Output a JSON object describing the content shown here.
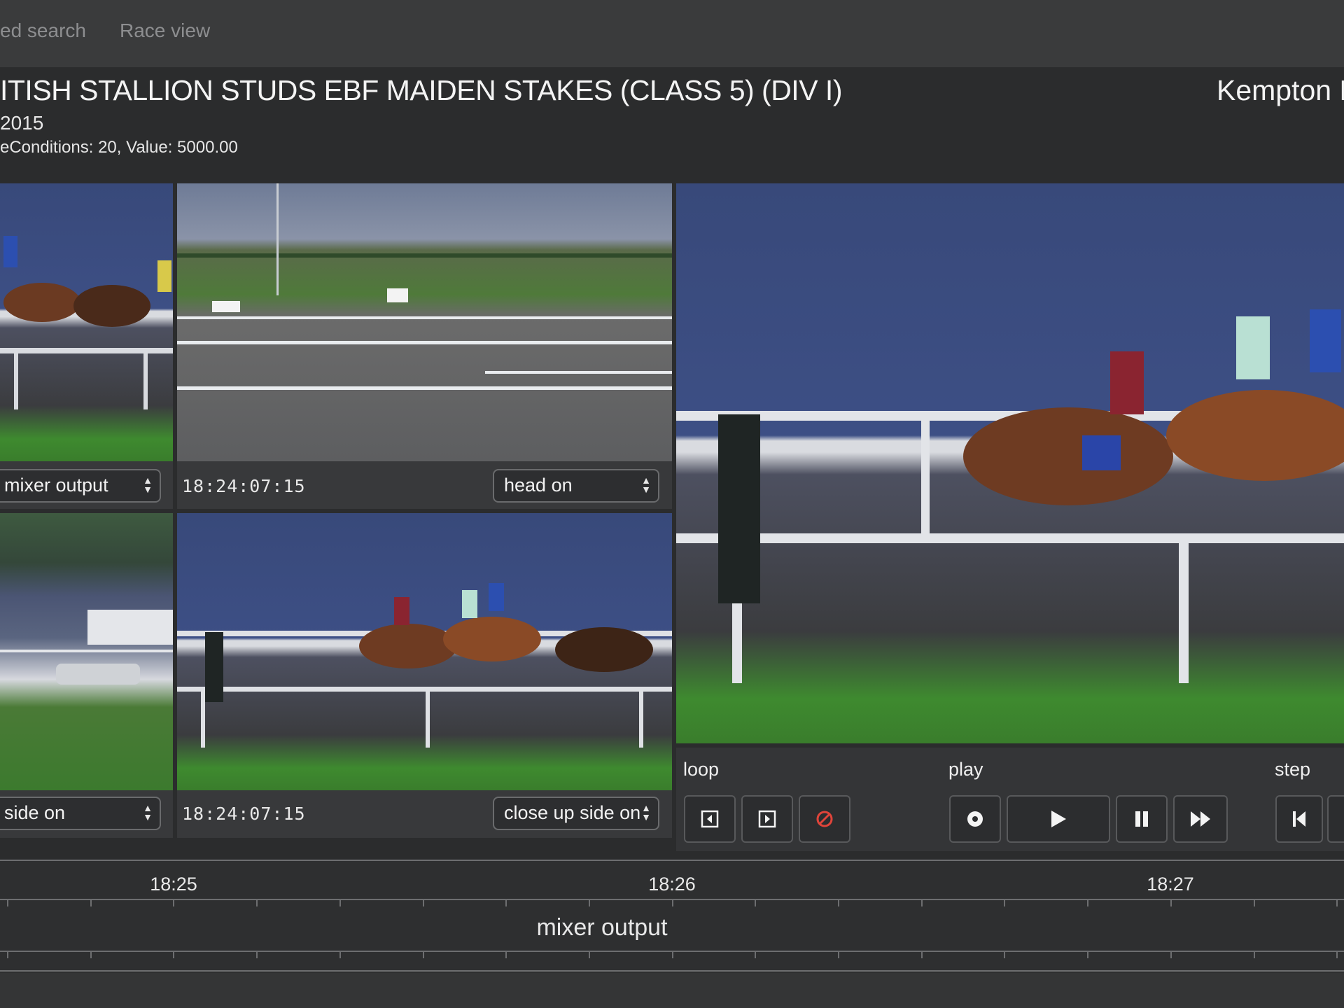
{
  "nav": {
    "tabs": [
      {
        "label": "ed search"
      },
      {
        "label": "Race view"
      }
    ]
  },
  "race": {
    "title": "ITISH STALLION STUDS EBF MAIDEN STAKES (CLASS 5) (DIV I)",
    "venue": "Kempton P",
    "date": "2015",
    "conditions": "eConditions: 20, Value: 5000.00"
  },
  "panels": [
    {
      "timecode": "",
      "camera": "mixer output"
    },
    {
      "timecode": "18:24:07:15",
      "camera": "head on"
    },
    {
      "timecode": "",
      "camera": "side on"
    },
    {
      "timecode": "18:24:07:15",
      "camera": "close up side on"
    }
  ],
  "controls": {
    "loop_label": "loop",
    "play_label": "play",
    "step_label": "step",
    "colors": {
      "cancel": "#e0443a"
    }
  },
  "timeline": {
    "times": [
      "18:25",
      "18:26",
      "18:27"
    ],
    "track_label": "mixer output"
  }
}
